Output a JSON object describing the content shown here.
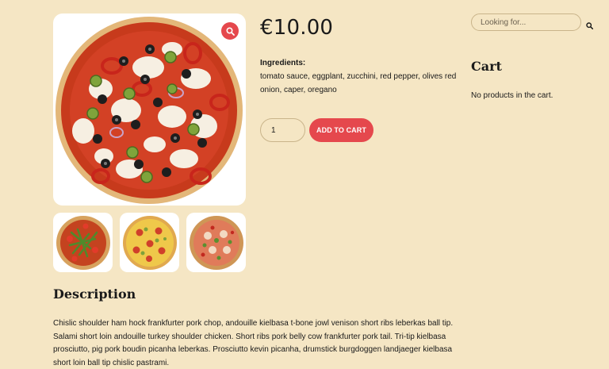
{
  "product": {
    "price": "€10.00",
    "ingredients_title": "Ingredients:",
    "ingredients_text": "tomato sauce, eggplant, zucchini, red pepper, olives red onion, caper, oregano",
    "quantity_value": "1",
    "add_to_cart_label": "ADD TO CART"
  },
  "gallery": {
    "main_image": "pizza-main-image",
    "zoom_icon": "magnifier-icon",
    "thumbnails": [
      "pizza-arugula-thumbnail",
      "pizza-cheese-thumbnail",
      "pizza-mixed-thumbnail"
    ]
  },
  "sidebar": {
    "search_placeholder": "Looking for...",
    "search_icon": "search-icon",
    "cart_title": "Cart",
    "cart_empty_text": "No products in the cart."
  },
  "description": {
    "title": "Description",
    "text": "Chislic shoulder ham hock frankfurter pork chop, andouille kielbasa t-bone jowl venison short ribs leberkas ball tip. Salami short loin andouille turkey shoulder chicken. Short ribs pork belly cow frankfurter pork tail. Tri-tip kielbasa prosciutto, pig pork boudin picanha leberkas. Prosciutto kevin picanha, drumstick burgdoggen landjaeger kielbasa short loin ball tip chislic pastrami."
  },
  "colors": {
    "background": "#f5e6c4",
    "accent": "#e5484d",
    "border": "#c9b48a",
    "text": "#1a1a1a"
  }
}
